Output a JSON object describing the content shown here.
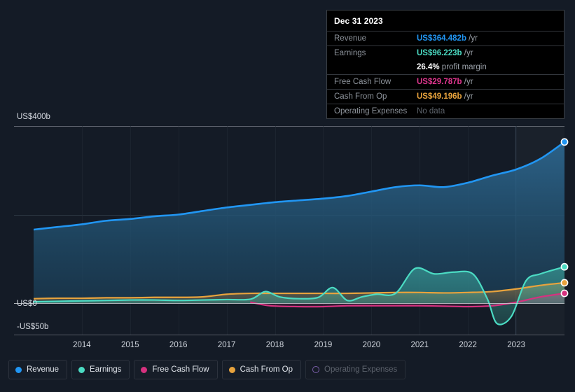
{
  "chart_data": {
    "type": "area",
    "title": "",
    "xlabel": "",
    "ylabel": "",
    "currency": "US$",
    "grid": true,
    "legend_position": "bottom-left",
    "xlim": [
      2013.5,
      2024.5
    ],
    "ylim": [
      -50,
      400
    ],
    "x_tick_labels": [
      "2014",
      "2015",
      "2016",
      "2017",
      "2018",
      "2019",
      "2020",
      "2021",
      "2022",
      "2023"
    ],
    "y_tick_labels": [
      "US$400b",
      "US$0",
      "-US$50b"
    ],
    "y_tick_values": [
      400,
      0,
      -50
    ],
    "gridlines": [
      400,
      200,
      0
    ],
    "forecast_start": 2023.5,
    "series": [
      {
        "name": "Revenue",
        "color": "#2196f3",
        "unit": "b",
        "x": [
          2013.5,
          2014.0,
          2014.5,
          2015.0,
          2015.5,
          2016.0,
          2016.5,
          2017.0,
          2017.5,
          2018.0,
          2018.5,
          2019.0,
          2019.5,
          2020.0,
          2020.5,
          2021.0,
          2021.5,
          2022.0,
          2022.5,
          2023.0,
          2023.5,
          2024.0,
          2024.5
        ],
        "values": [
          166,
          172,
          178,
          186,
          190,
          196,
          200,
          208,
          216,
          222,
          228,
          232,
          236,
          242,
          252,
          262,
          266,
          262,
          272,
          288,
          302,
          326,
          364
        ]
      },
      {
        "name": "Earnings",
        "color": "#4bdbc3",
        "unit": "b",
        "x": [
          2013.5,
          2014.0,
          2014.5,
          2015.0,
          2015.5,
          2016.0,
          2016.5,
          2017.0,
          2017.5,
          2018.0,
          2018.3,
          2018.6,
          2019.0,
          2019.4,
          2019.7,
          2020.0,
          2020.3,
          2020.6,
          2021.0,
          2021.4,
          2021.8,
          2022.2,
          2022.6,
          2022.9,
          2023.1,
          2023.4,
          2023.7,
          2024.0,
          2024.5
        ],
        "values": [
          3,
          4,
          5,
          6,
          7,
          7,
          6,
          7,
          8,
          9,
          26,
          14,
          10,
          13,
          35,
          6,
          14,
          20,
          22,
          78,
          66,
          70,
          66,
          10,
          -46,
          -30,
          50,
          66,
          82
        ]
      },
      {
        "name": "Free Cash Flow",
        "color": "#d6317f",
        "unit": "b",
        "x": [
          2018.0,
          2018.4,
          2019.0,
          2019.5,
          2020.0,
          2020.5,
          2021.0,
          2021.5,
          2022.0,
          2022.5,
          2023.0,
          2023.5,
          2024.0,
          2024.5
        ],
        "values": [
          2,
          -6,
          -8,
          -8,
          -6,
          -6,
          -6,
          -6,
          -7,
          -8,
          -6,
          2,
          14,
          22
        ]
      },
      {
        "name": "Cash From Op",
        "color": "#e8a33d",
        "unit": "b",
        "x": [
          2013.5,
          2014.0,
          2014.5,
          2015.0,
          2015.5,
          2016.0,
          2016.5,
          2017.0,
          2017.5,
          2018.0,
          2018.5,
          2019.0,
          2019.5,
          2020.0,
          2020.5,
          2021.0,
          2021.5,
          2022.0,
          2022.5,
          2023.0,
          2023.5,
          2024.0,
          2024.5
        ],
        "values": [
          10,
          11,
          11,
          12,
          12,
          13,
          13,
          14,
          20,
          22,
          22,
          22,
          22,
          22,
          23,
          24,
          24,
          23,
          24,
          26,
          32,
          40,
          46
        ]
      },
      {
        "name": "Operating Expenses",
        "color": "#7a5ea8",
        "unit": "b",
        "disabled": true,
        "x": [],
        "values": []
      }
    ]
  },
  "tooltip": {
    "title": "Dec 31 2023",
    "rows": [
      {
        "key": "Revenue",
        "value": "US$364.482b",
        "unit": "/yr",
        "color": "#2196f3"
      },
      {
        "key": "Earnings",
        "value": "US$96.223b",
        "unit": "/yr",
        "color": "#4bdbc3"
      },
      {
        "key": "",
        "value": "26.4%",
        "unit": "profit margin",
        "color": "#ffffff"
      },
      {
        "key": "Free Cash Flow",
        "value": "US$29.787b",
        "unit": "/yr",
        "color": "#e0368f"
      },
      {
        "key": "Cash From Op",
        "value": "US$49.196b",
        "unit": "/yr",
        "color": "#e8a33d"
      },
      {
        "key": "Operating Expenses",
        "value": "No data",
        "unit": "",
        "color": "#5d636b"
      }
    ]
  },
  "legend": {
    "items": [
      {
        "label": "Revenue",
        "color": "#2196f3",
        "active": true
      },
      {
        "label": "Earnings",
        "color": "#4bdbc3",
        "active": true
      },
      {
        "label": "Free Cash Flow",
        "color": "#d6317f",
        "active": true
      },
      {
        "label": "Cash From Op",
        "color": "#e8a33d",
        "active": true
      },
      {
        "label": "Operating Expenses",
        "color": "#7a5ea8",
        "active": false
      }
    ]
  },
  "axis": {
    "y_top_label": "US$400b",
    "y_zero_label": "US$0",
    "y_bottom_label": "-US$50b"
  }
}
